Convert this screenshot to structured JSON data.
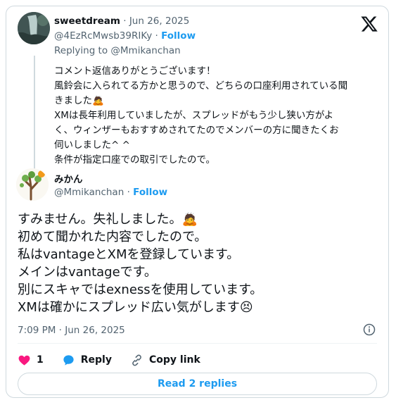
{
  "quoted": {
    "display_name": "sweetdream",
    "dot": "·",
    "date": "Jun 26, 2025",
    "handle": "@4EzRcMwsb39RIKy",
    "follow_label": "Follow",
    "replying_prefix": "Replying to",
    "replying_to": "@Mmikanchan",
    "lines": [
      "コメント返信ありがとうございます！",
      "風鈴会に入られてる方かと思うので、どちらの口座利用されている聞",
      "きました🙇",
      "XMは長年利用していましたが、スプレッドがもう少し狭い方がよ",
      "く、ウィンザーもおすすめされてたのでメンバーの方に聞きたくお",
      "伺いしました^ ^",
      "条件が指定口座での取引でしたので。"
    ]
  },
  "main": {
    "display_name": "みかん",
    "handle": "@Mmikanchan",
    "dot": "·",
    "follow_label": "Follow",
    "lines": [
      "すみません。失礼しました。🙇",
      "初めて聞かれた内容でしたので。",
      "私はvantageとXMを登録しています。",
      "メインはvantageです。",
      "別にスキャではexnessを使用しています。",
      "XMは確かにスプレッド広い気がします😣"
    ],
    "timestamp": "7:09 PM · Jun 26, 2025"
  },
  "actions": {
    "like_count": "1",
    "reply_label": "Reply",
    "copy_label": "Copy link"
  },
  "read_replies_label": "Read 2 replies",
  "icons": {
    "logo": "x-logo-icon",
    "like": "heart-icon",
    "reply": "speech-bubble-icon",
    "copy": "link-icon",
    "info": "info-icon"
  },
  "colors": {
    "accent": "#1d9bf0",
    "like": "#f91880",
    "muted": "#536471",
    "border": "#cfd9de"
  }
}
